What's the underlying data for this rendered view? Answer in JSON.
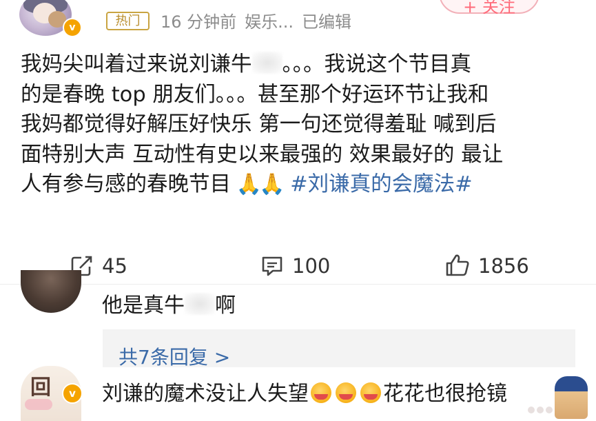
{
  "post": {
    "hot_tag": "热门",
    "time": "16 分钟前",
    "source": "娱乐...",
    "edited": "已编辑",
    "follow_label": "+ 关注",
    "body_lines": [
      [
        "我妈尖叫着过来说刘谦牛",
        "。。。我说这个节目真"
      ],
      "的是春晚 top 朋友们。。。甚至那个好运环节让我和",
      "我妈都觉得好解压好快乐 第一句还觉得羞耻 喊到后",
      "面特别大声 互动性有史以来最强的 效果最好的 最让"
    ],
    "body_last_line": "人有参与感的春晚节目",
    "hashtag": "#刘谦真的会魔法#"
  },
  "actions": {
    "repost_count": "45",
    "comment_count": "100",
    "like_count": "1856"
  },
  "comments": [
    {
      "text_before": "他是真牛",
      "text_after": "啊",
      "replies_link": "共7条回复 >"
    },
    {
      "text_main": "刘谦的魔术没让人失望",
      "text_tail": "花花也很抢镜"
    }
  ],
  "icons": [
    "repost-icon",
    "comment-icon",
    "like-icon",
    "pray-emoji",
    "face-emoji",
    "verified-badge-icon"
  ],
  "colors": {
    "link": "#3a6aa8",
    "hot_tag": "#b88c2a",
    "verified": "#f5a300",
    "follow": "#ff6b7a"
  }
}
